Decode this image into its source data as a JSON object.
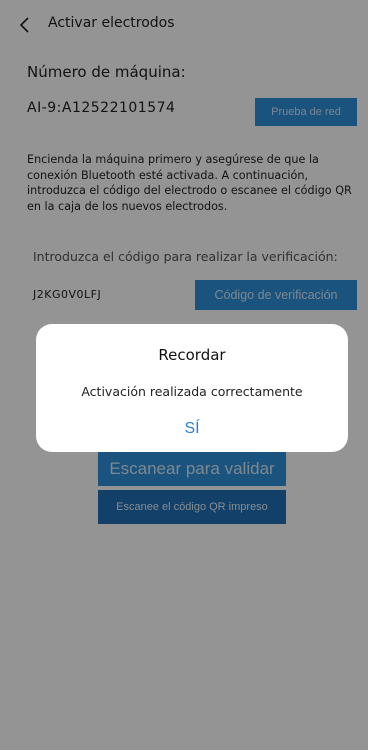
{
  "header": {
    "back_icon": "chevron-left-icon",
    "title": "Activar electrodos"
  },
  "machine": {
    "label": "Número de máquina:",
    "id": "AI-9:A12522101574",
    "test_button": "Prueba de red"
  },
  "instructions": "Encienda la máquina primero y asegúrese de que la conexión Bluetooth esté activada. A continuación, introduzca el código del electrodo o escanee el código QR en la caja de los nuevos electrodos.",
  "verification": {
    "label": "Introduzca el código para realizar la verificación:",
    "code_value": "J2KG0V0LFJ",
    "verify_button": "Código de verificación"
  },
  "scan": {
    "scan_button": "Escanear para validar",
    "scan_printed_button": "Escanee el código QR impreso"
  },
  "dialog": {
    "title": "Recordar",
    "message": "Activación realizada correctamente",
    "confirm": "SÍ"
  },
  "colors": {
    "accent": "#2d8fd8",
    "accent_dark": "#1f6fb3",
    "overlay": "rgba(0,0,0,0.42)"
  }
}
